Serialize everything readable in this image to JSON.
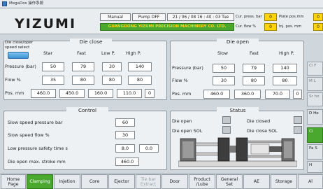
{
  "window": {
    "title": "MegaDos 操作系統"
  },
  "header": {
    "logo_text": "YIZUMI",
    "mode": "Manual",
    "pump": "Pump OFF",
    "datetime": "21 / 06 / 08 16 : 40 : 03 Tue",
    "company": "GUANGDONG YIZUMI PRECISION MACHINERY CO. LTD.",
    "cur_press_label": "Cur. press. bar",
    "cur_press_value": "0",
    "cur_flow_label": "Cur. flow  %",
    "cur_flow_value": "0",
    "plate_pos_label": "Plate pos.mm",
    "plate_pos_value": "0",
    "inj_pos_label": "Inj. pos. mm",
    "inj_pos_value": "0"
  },
  "die_close": {
    "title": "Die close",
    "speed_select_label": "Die close/oper speed select",
    "col_headers": [
      "Star",
      "Fast",
      "Low P.",
      "High P."
    ],
    "pressure_label": "Pressure (bar)",
    "pressure": [
      "50",
      "79",
      "30",
      "140"
    ],
    "flow_label": "Flow %",
    "flow": [
      "35",
      "80",
      "80",
      "80"
    ],
    "pos_label": "Pos. mm",
    "pos": [
      "460.0",
      "450.0",
      "160.0",
      "110.0",
      "0"
    ]
  },
  "die_open": {
    "title": "Die open",
    "col_headers": [
      "Slow",
      "Fast",
      "High P."
    ],
    "pressure_label": "Pressure (bar)",
    "pressure": [
      "50",
      "79",
      "140"
    ],
    "flow_label": "Flow %",
    "flow": [
      "30",
      "80",
      "80"
    ],
    "pos_label": "Pos. mm",
    "pos": [
      "460.0",
      "360.0",
      "70.0",
      "0"
    ]
  },
  "control": {
    "title": "Control",
    "rows": [
      {
        "label": "Slow speed pressure bar",
        "value": "60"
      },
      {
        "label": "Slow speed flow %",
        "value": "30"
      },
      {
        "label": "Low pressure safety time  s",
        "value": "8.0",
        "value2": "0.0"
      },
      {
        "label": "Die open max. stroke mm",
        "value": "460.0"
      }
    ]
  },
  "status": {
    "title": "Status",
    "items": [
      "Die open",
      "Die closed",
      "Die open SOL",
      "Die close SOL"
    ]
  },
  "side": {
    "buttons": [
      "Cl F",
      "M L",
      "Sr ho",
      "D He",
      "Cl",
      "Pa S",
      "H"
    ]
  },
  "nav": {
    "items": [
      "Home\nPage",
      "Clamping",
      "Injetion",
      "Core",
      "Ejector",
      "Tie bar\nExtract",
      "Door",
      "Product\n/Lube",
      "General\nSet",
      "AE",
      "Storage",
      "Al"
    ]
  },
  "colors": {
    "accent_green": "#4aa82f",
    "highlight_yellow": "#ffd400",
    "selected_blue": "#3d93d3"
  }
}
